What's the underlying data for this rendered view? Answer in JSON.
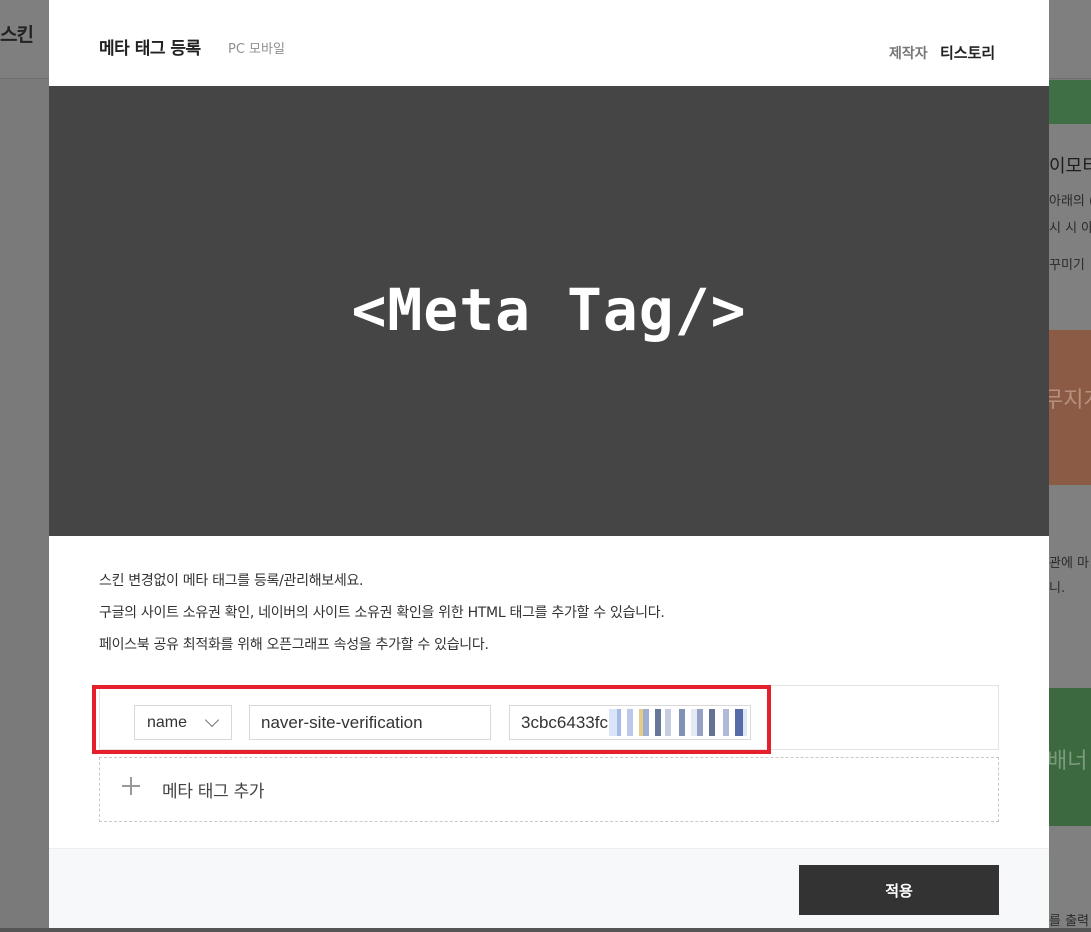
{
  "background": {
    "logo_fragment": "스킨",
    "right_texts": [
      "이모티",
      "아래의 (",
      "시 시 아",
      "꾸미기",
      "관에 마",
      "니."
    ],
    "orange_card_text": "무지개",
    "green_banner_text": "배너",
    "bottom_text": "를 출력"
  },
  "modal": {
    "title": "메타 태그 등록",
    "subtitle": "PC 모바일",
    "maker_label": "제작자",
    "maker_name": "티스토리",
    "hero_text": "<Meta Tag/>",
    "description": [
      "스킨 변경없이 메타 태그를 등록/관리해보세요.",
      "구글의 사이트 소유권 확인, 네이버의 사이트 소유권 확인을 위한 HTML 태그를 추가할 수 있습니다.",
      "페이스북 공유 최적화를 위해 오픈그래프 속성을 추가할 수 있습니다."
    ],
    "tag_row": {
      "attribute": "name",
      "name_value": "naver-site-verification",
      "content_value": "3cbc6433fc"
    },
    "add_tag_label": "메타 태그 추가",
    "apply_label": "적용"
  },
  "colors": {
    "hero_bg": "#454545",
    "highlight": "#e3202b",
    "apply_bg": "#333333"
  }
}
